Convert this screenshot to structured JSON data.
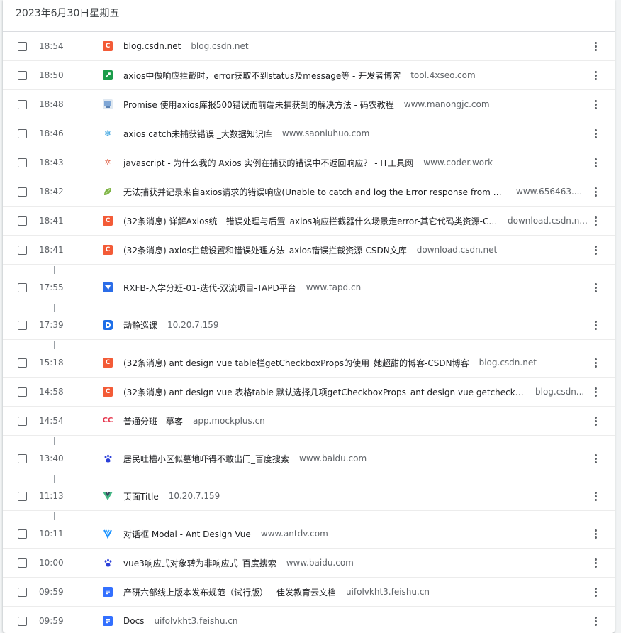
{
  "date_heading": "2023年6月30日星期五",
  "entries": [
    {
      "time": "18:54",
      "title": "blog.csdn.net",
      "domain": "blog.csdn.net",
      "icon": "csdn-icon"
    },
    {
      "time": "18:50",
      "title": "axios中做响应拦截时，error获取不到status及message等 - 开发者博客",
      "domain": "tool.4xseo.com",
      "icon": "4xseo-icon"
    },
    {
      "time": "18:48",
      "title": "Promise 使用axios库报500错误而前端未捕获到的解决方法 - 码农教程",
      "domain": "www.manongjc.com",
      "icon": "manongjc-icon"
    },
    {
      "time": "18:46",
      "title": "axios catch未捕获错误 _大数据知识库",
      "domain": "www.saoniuhuo.com",
      "icon": "saoniuhuo-icon"
    },
    {
      "time": "18:43",
      "title": "javascript - 为什么我的 Axios 实例在捕获的错误中不返回响应？ - IT工具网",
      "domain": "www.coder.work",
      "icon": "coder-work-icon"
    },
    {
      "time": "18:42",
      "title": "无法捕获并记录来自axios请求的错误响应(Unable to catch and log the Error response from an axios req...",
      "domain": "www.656463....",
      "icon": "leaf-icon"
    },
    {
      "time": "18:41",
      "title": "(32条消息) 详解Axios统一错误处理与后置_axios响应拦截器什么场景走error-其它代码类资源-CSDN...",
      "domain": "download.csdn.n...",
      "icon": "csdn-icon"
    },
    {
      "time": "18:41",
      "title": "(32条消息) axios拦截设置和错误处理方法_axios错误拦截资源-CSDN文库",
      "domain": "download.csdn.net",
      "icon": "csdn-icon"
    },
    {
      "time": "17:55",
      "title": "RXFB-入学分班-01-迭代-双流项目-TAPD平台",
      "domain": "www.tapd.cn",
      "icon": "tapd-icon"
    },
    {
      "time": "17:39",
      "title": "动静巡课",
      "domain": "10.20.7.159",
      "icon": "dongjing-icon"
    },
    {
      "time": "15:18",
      "title": "(32条消息) ant design vue table栏getCheckboxProps的使用_她超甜的博客-CSDN博客",
      "domain": "blog.csdn.net",
      "icon": "csdn-icon"
    },
    {
      "time": "14:58",
      "title": "(32条消息) ant design vue 表格table 默认选择几项getCheckboxProps_ant design vue getcheckboxprops_一...",
      "domain": "blog.csdn...",
      "icon": "csdn-icon"
    },
    {
      "time": "14:54",
      "title": "普通分班 - 摹客",
      "domain": "app.mockplus.cn",
      "icon": "mockplus-icon"
    },
    {
      "time": "13:40",
      "title": "居民吐槽小区似墓地吓得不敢出门_百度搜索",
      "domain": "www.baidu.com",
      "icon": "baidu-paw-icon"
    },
    {
      "time": "11:13",
      "title": "页面Title",
      "domain": "10.20.7.159",
      "icon": "vue-logo-icon"
    },
    {
      "time": "10:11",
      "title": "对话框 Modal - Ant Design Vue",
      "domain": "www.antdv.com",
      "icon": "antdv-icon"
    },
    {
      "time": "10:00",
      "title": "vue3响应式对象转为非响应式_百度搜索",
      "domain": "www.baidu.com",
      "icon": "baidu-paw-icon"
    },
    {
      "time": "09:59",
      "title": "产研六部线上版本发布规范（试行版） - 佳发教育云文档",
      "domain": "uifolvkht3.feishu.cn",
      "icon": "feishu-doc-icon"
    },
    {
      "time": "09:59",
      "title": "Docs",
      "domain": "uifolvkht3.feishu.cn",
      "icon": "feishu-doc-icon"
    }
  ]
}
